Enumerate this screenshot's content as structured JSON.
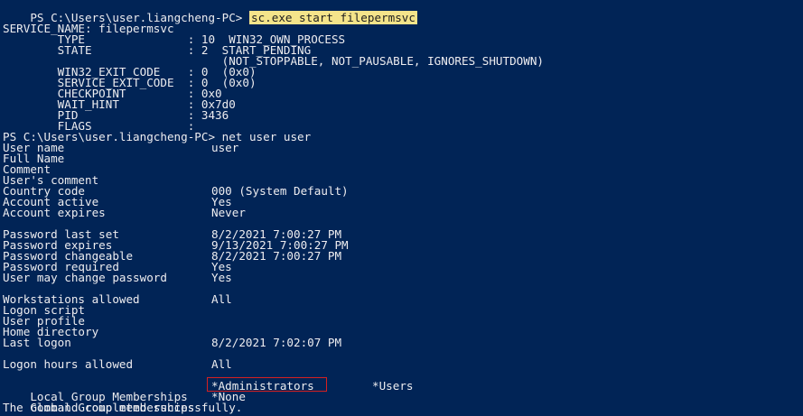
{
  "prompt1": "PS C:\\Users\\user.liangcheng-PC>",
  "cmd1": "sc.exe start filepermsvc",
  "service_lines": [
    {
      "label": "SERVICE_NAME: filepermsvc",
      "value": ""
    },
    {
      "label": "        TYPE               : 10  WIN32_OWN_PROCESS",
      "value": ""
    },
    {
      "label": "        STATE              : 2  START_PENDING",
      "value": ""
    },
    {
      "label": "                                (NOT_STOPPABLE, NOT_PAUSABLE, IGNORES_SHUTDOWN)",
      "value": ""
    },
    {
      "label": "        WIN32_EXIT_CODE    : 0  (0x0)",
      "value": ""
    },
    {
      "label": "        SERVICE_EXIT_CODE  : 0  (0x0)",
      "value": ""
    },
    {
      "label": "        CHECKPOINT         : 0x0",
      "value": ""
    },
    {
      "label": "        WAIT_HINT          : 0x7d0",
      "value": ""
    },
    {
      "label": "        PID                : 3436",
      "value": ""
    },
    {
      "label": "        FLAGS              :",
      "value": ""
    }
  ],
  "prompt2": "PS C:\\Users\\user.liangcheng-PC> net user user",
  "user_rows": [
    {
      "label": "User name",
      "value": "user"
    },
    {
      "label": "Full Name",
      "value": ""
    },
    {
      "label": "Comment",
      "value": ""
    },
    {
      "label": "User's comment",
      "value": ""
    },
    {
      "label": "Country code",
      "value": "000 (System Default)"
    },
    {
      "label": "Account active",
      "value": "Yes"
    },
    {
      "label": "Account expires",
      "value": "Never"
    },
    {
      "label": "",
      "value": ""
    },
    {
      "label": "Password last set",
      "value": "8/2/2021 7:00:27 PM"
    },
    {
      "label": "Password expires",
      "value": "9/13/2021 7:00:27 PM"
    },
    {
      "label": "Password changeable",
      "value": "8/2/2021 7:00:27 PM"
    },
    {
      "label": "Password required",
      "value": "Yes"
    },
    {
      "label": "User may change password",
      "value": "Yes"
    },
    {
      "label": "",
      "value": ""
    },
    {
      "label": "Workstations allowed",
      "value": "All"
    },
    {
      "label": "Logon script",
      "value": ""
    },
    {
      "label": "User profile",
      "value": ""
    },
    {
      "label": "Home directory",
      "value": ""
    },
    {
      "label": "Last logon",
      "value": "8/2/2021 7:02:07 PM"
    },
    {
      "label": "",
      "value": ""
    },
    {
      "label": "Logon hours allowed",
      "value": "All"
    },
    {
      "label": "",
      "value": ""
    }
  ],
  "local_groups_label": "Local Group Memberships",
  "local_group_1": "*Administrators",
  "local_group_2": "*Users",
  "global_groups_label": "Global Group memberships",
  "global_group_1": "*None",
  "completion": "The command completed successfully.",
  "colors": {
    "background": "#012456",
    "text": "#eeedf0",
    "highlight": "#f4e48a",
    "box": "#d62020"
  }
}
